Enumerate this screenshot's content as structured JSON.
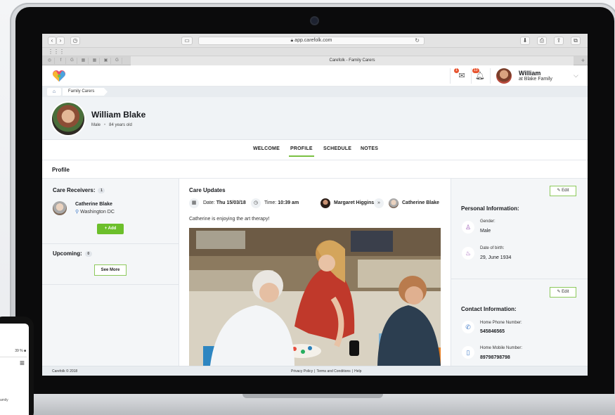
{
  "browser": {
    "url": "app.carefolk.com",
    "tab_title": "Carefolk - Family Carers",
    "pinned_tabs": [
      "◎",
      "f",
      "G",
      "▦",
      "▦",
      "▣",
      "G"
    ]
  },
  "header": {
    "messages_count": "1",
    "notifications_count": "13",
    "user_name": "William",
    "user_family": "at Blake Family"
  },
  "breadcrumb": {
    "current": "Family Carers"
  },
  "profile": {
    "name": "William Blake",
    "gender": "Male",
    "age": "84 years old"
  },
  "nav": {
    "tabs": [
      "WELCOME",
      "PROFILE",
      "SCHEDULE",
      "NOTES"
    ],
    "active": "PROFILE"
  },
  "section_title": "Profile",
  "left": {
    "receivers_label": "Care Receivers:",
    "receivers_count": "1",
    "receiver_name": "Catherine Blake",
    "receiver_location": "Washington DC",
    "add_label": "+ Add",
    "upcoming_label": "Upcoming:",
    "upcoming_count": "0",
    "see_more_label": "See More"
  },
  "care_updates": {
    "title": "Care Updates",
    "date_label": "Date:",
    "date_value": "Thu 15/03/18",
    "time_label": "Time:",
    "time_value": "10:39 am",
    "from_person": "Margaret Higgins",
    "to_person": "Catherine Blake",
    "message": "Catherine is enjoying the art therapy!"
  },
  "right": {
    "edit_label": "Edit",
    "personal_title": "Personal Information:",
    "gender_label": "Gender:",
    "gender_value": "Male",
    "dob_label": "Date of birth:",
    "dob_value": "29, June 1934",
    "contact_title": "Contact Information:",
    "home_phone_label": "Home Phone Number:",
    "home_phone_value": "545846565",
    "mobile_label": "Home Mobile Number:",
    "mobile_value": "89798798798"
  },
  "footer": {
    "copyright": "Carefolk © 2018",
    "privacy": "Privacy Policy",
    "terms": "Terms and Conditions",
    "help": "Help"
  },
  "phone": {
    "battery": "39 % ■",
    "family_text": "amily"
  },
  "colors": {
    "accent_green": "#6cbf2b",
    "badge_orange": "#e8542f",
    "link_blue": "#3d79c7"
  }
}
